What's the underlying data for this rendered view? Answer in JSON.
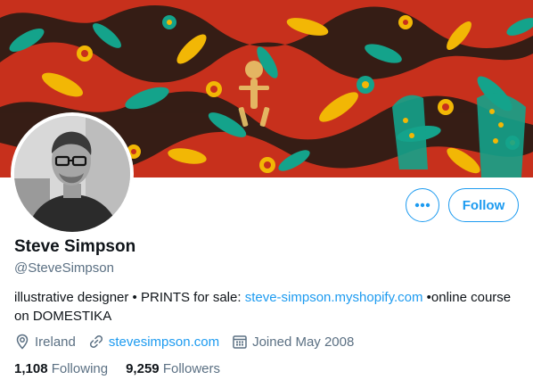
{
  "profile": {
    "name": "Steve Simpson",
    "handle": "@SteveSimpson",
    "bio_text_1": "illustrative designer • PRINTS for sale: ",
    "bio_link": "steve-simpson.myshopify.com",
    "bio_text_2": " •online course on DOMESTIKA",
    "location": "Ireland",
    "website": "stevesimpson.com",
    "joined": "Joined May 2008"
  },
  "actions": {
    "follow_label": "Follow",
    "more_icon": "more-horizontal-icon"
  },
  "stats": {
    "following_count": "1,108",
    "following_label": "Following",
    "followers_count": "9,259",
    "followers_label": "Followers"
  },
  "colors": {
    "accent": "#1d9bf0",
    "secondary_text": "#5b7083",
    "banner_red": "#c7301c",
    "banner_teal": "#14a38b",
    "banner_yellow": "#f2b705"
  }
}
